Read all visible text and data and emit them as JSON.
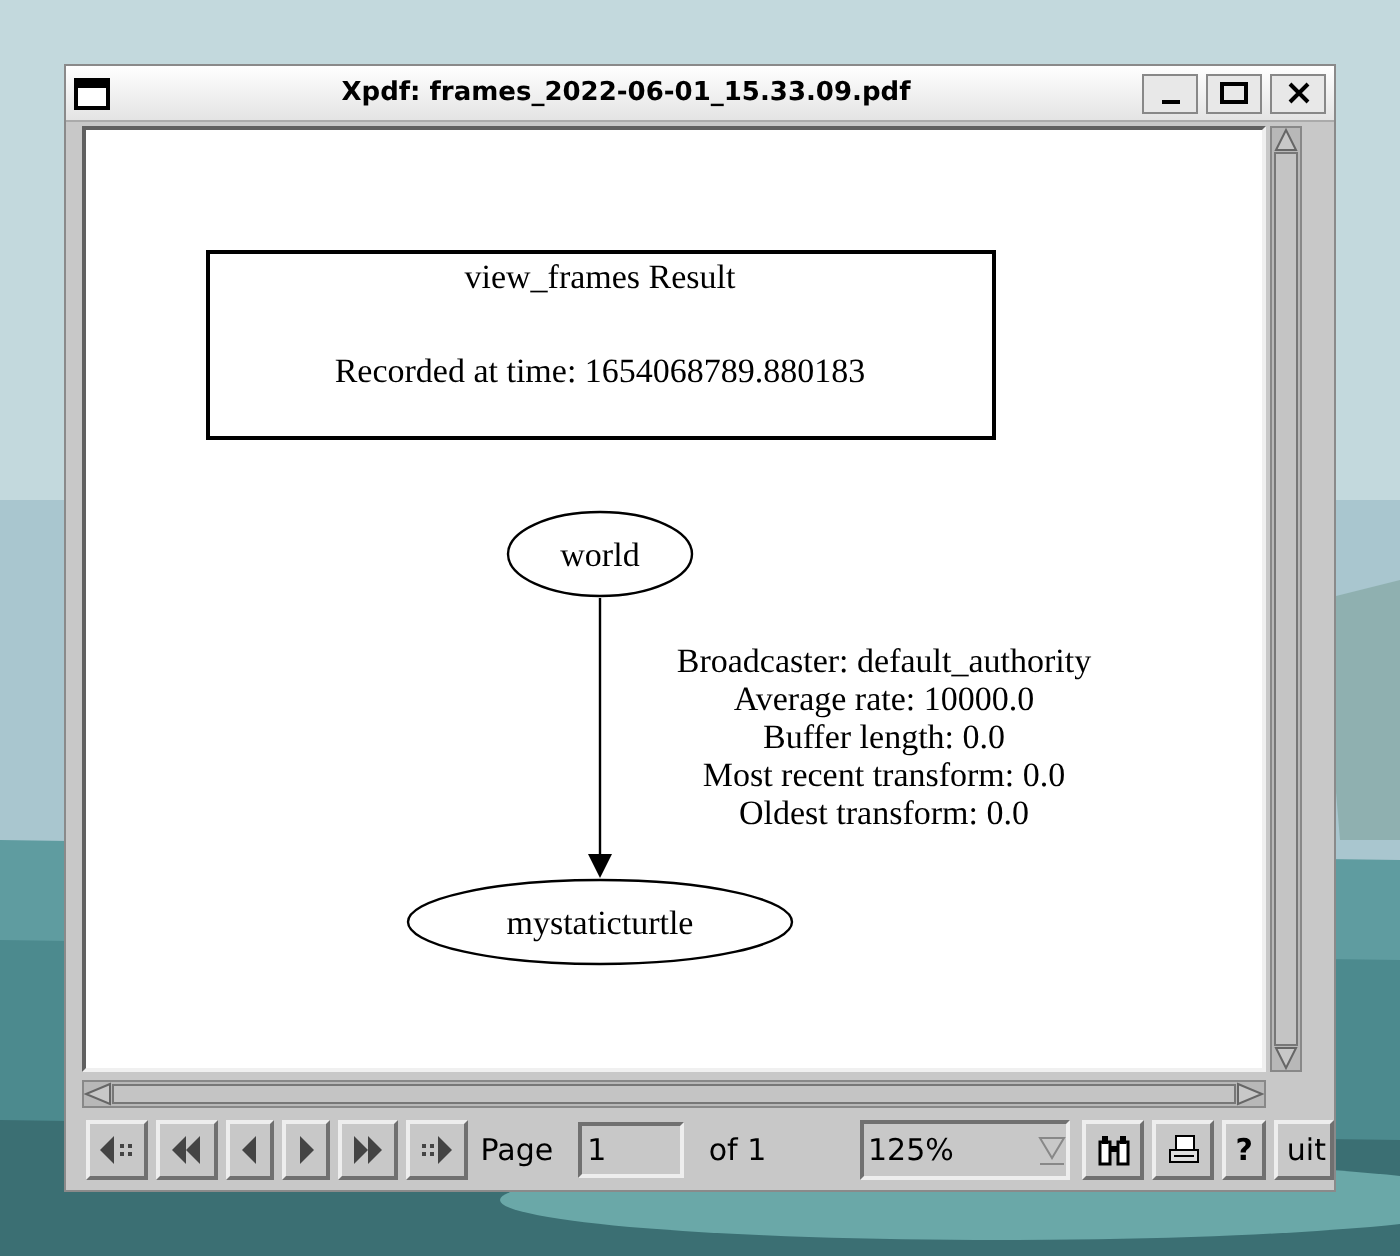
{
  "window": {
    "title": "Xpdf: frames_2022-06-01_15.33.09.pdf"
  },
  "graph": {
    "title_box": {
      "title": "view_frames Result",
      "subtitle": "Recorded at time: 1654068789.880183"
    },
    "nodes": [
      "world",
      "mystaticturtle"
    ],
    "edge_label": [
      "Broadcaster: default_authority",
      "Average rate: 10000.0",
      "Buffer length: 0.0",
      "Most recent transform: 0.0",
      "Oldest transform: 0.0"
    ]
  },
  "toolbar": {
    "page_label": "Page",
    "page_field": "1",
    "page_count": "of 1",
    "zoom": "125%",
    "help": "?",
    "quit": "uit"
  }
}
